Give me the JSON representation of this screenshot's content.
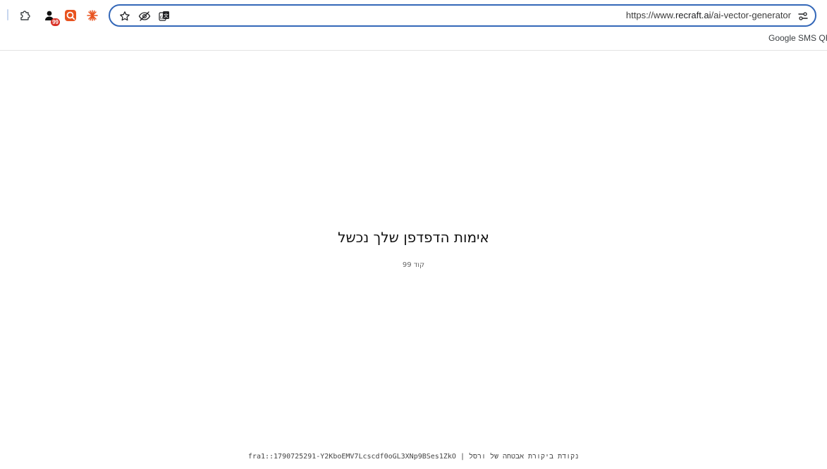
{
  "toolbar": {
    "extensions": [
      {
        "name": "extensions-puzzle-icon"
      },
      {
        "name": "profile-extension-icon",
        "badge": "99"
      },
      {
        "name": "search-lens-extension-icon"
      },
      {
        "name": "sparkle-extension-icon"
      }
    ],
    "omnibox": {
      "icons": [
        "bookmark-star-icon",
        "eye-off-icon",
        "translate-icon"
      ],
      "url_scheme_host": "https://www.",
      "url_domain": "recraft.ai",
      "url_path": "/ai-vector-generator",
      "settings_icon": "site-settings-tune-icon"
    }
  },
  "bookmarks": {
    "items": [
      "Google SMS QR E"
    ]
  },
  "page": {
    "title": "אימות הדפדפן שלך נכשל",
    "code": "קוד 99",
    "footer": "נקודת ביקורת אבטחה של ורסל | fra1::1790725291-Y2KboEMV7Lcscdf0oGL3XNp9BSes1ZkO"
  },
  "colors": {
    "omnibox_border": "#3367b8",
    "badge": "#d93025",
    "accent_orange": "#e8531f"
  }
}
